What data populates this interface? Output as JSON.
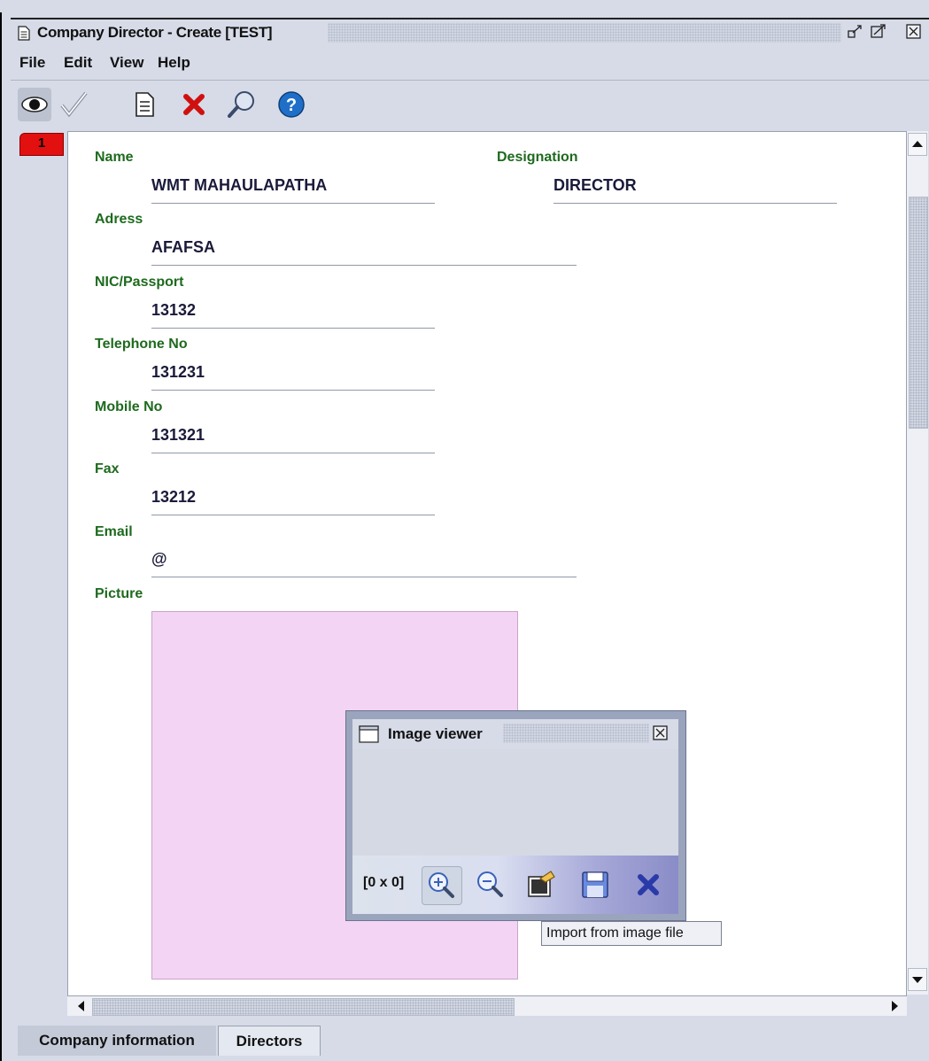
{
  "window": {
    "title": "Company Director - Create [TEST]"
  },
  "menu": {
    "items": [
      "File",
      "Edit",
      "View",
      "Help"
    ]
  },
  "toolbar": {
    "buttons": [
      "eye-icon",
      "checkmark-icon",
      "document-icon",
      "delete-x-icon",
      "search-icon",
      "help-icon"
    ]
  },
  "record": {
    "tab_number": "1"
  },
  "form": {
    "name_label": "Name",
    "name_value": "WMT MAHAULAPATHA",
    "designation_label": "Designation",
    "designation_value": "DIRECTOR",
    "address_label": "Adress",
    "address_value": "AFAFSA",
    "nic_label": "NIC/Passport",
    "nic_value": "13132",
    "telephone_label": "Telephone No",
    "telephone_value": "131231",
    "mobile_label": "Mobile No",
    "mobile_value": "131321",
    "fax_label": "Fax",
    "fax_value": "13212",
    "email_label": "Email",
    "email_value": "@",
    "picture_label": "Picture"
  },
  "image_viewer": {
    "title": "Image viewer",
    "size": "[0 x 0]",
    "tools": [
      "zoom-in-icon",
      "zoom-out-icon",
      "import-image-icon",
      "save-icon",
      "close-icon"
    ],
    "tooltip": "Import from image file"
  },
  "bottom_tabs": {
    "company_info": "Company information",
    "directors": "Directors"
  },
  "colors": {
    "label": "#1e6a1e",
    "record_tab": "#e31010",
    "picture_bg": "#f4d4f4"
  }
}
